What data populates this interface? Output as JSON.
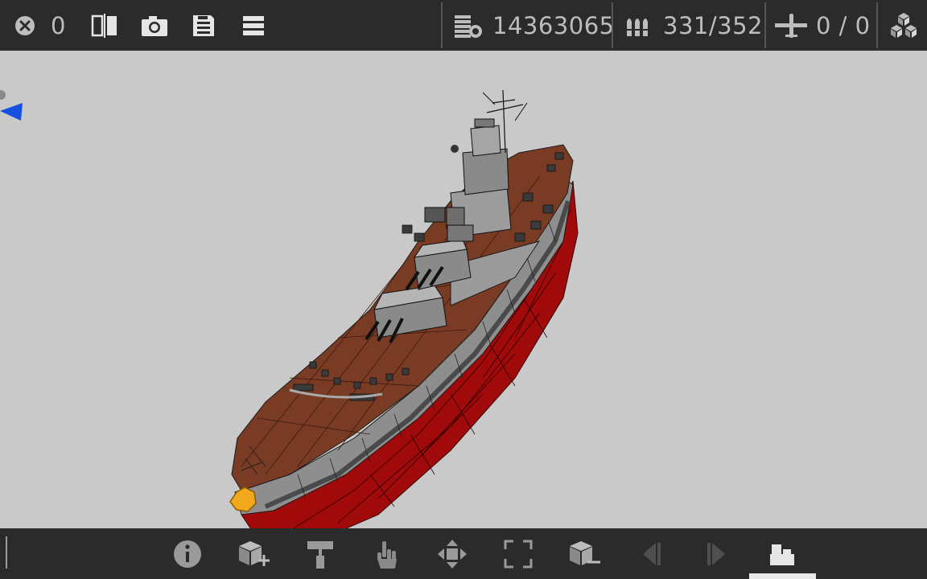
{
  "topbar": {
    "error_count": "0",
    "parts_count": "14363065",
    "ammo": "331/352",
    "aircraft": "0 / 0"
  },
  "icons": {
    "close": "close-circle-icon",
    "mirror": "mirror-split-icon",
    "camera": "camera-icon",
    "save": "floppy-save-icon",
    "menu": "hamburger-menu-icon",
    "parts": "parts-stack-icon",
    "ammo": "shells-icon",
    "aircraft": "airplane-icon",
    "blocks": "blocks-cubes-icon"
  },
  "bottom_tools": [
    "info",
    "add-block",
    "paint-roller",
    "hand-select",
    "move",
    "resize",
    "remove-block",
    "previous",
    "next",
    "props"
  ],
  "colors": {
    "bar": "#2b2b2b",
    "icon": "#bdbdbd",
    "background": "#c9c9c9",
    "deck": "#7a3b24",
    "hull_red": "#a00a0a",
    "hull_gray": "#8e8e8e",
    "indicator_blue": "#1550e0",
    "selection_gold": "#f2a81d"
  }
}
